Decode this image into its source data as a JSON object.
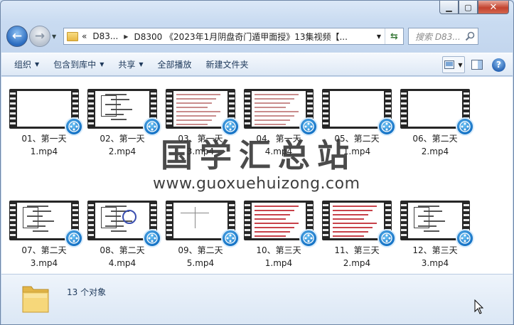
{
  "window": {
    "caption_buttons": [
      "minimize",
      "maximize",
      "close"
    ]
  },
  "address_bar": {
    "overflow": "«",
    "crumbs": [
      "D83...",
      "D8300 《2023年1月阴盘奇门遁甲面授》13集视频【..."
    ],
    "search_placeholder": "搜索 D83..."
  },
  "toolbar": {
    "organize": "组织",
    "include_in_library": "包含到库中",
    "share": "共享",
    "play_all": "全部播放",
    "new_folder": "新建文件夹"
  },
  "files": [
    {
      "line1": "01、第一天",
      "line2": "1.mp4"
    },
    {
      "line1": "02、第一天",
      "line2": "2.mp4"
    },
    {
      "line1": "03、第一天",
      "line2": "3.mp4"
    },
    {
      "line1": "04、第一天",
      "line2": "4.mp4"
    },
    {
      "line1": "05、第二天",
      "line2": "1.mp4"
    },
    {
      "line1": "06、第二天",
      "line2": "2.mp4"
    },
    {
      "line1": "07、第二天",
      "line2": "3.mp4"
    },
    {
      "line1": "08、第二天",
      "line2": "4.mp4"
    },
    {
      "line1": "09、第二天",
      "line2": "5.mp4"
    },
    {
      "line1": "10、第三天",
      "line2": "1.mp4"
    },
    {
      "line1": "11、第三天",
      "line2": "2.mp4"
    },
    {
      "line1": "12、第三天",
      "line2": "3.mp4"
    }
  ],
  "watermark": {
    "title": "国学汇总站",
    "url": "www.guoxuehuizong.com"
  },
  "status": {
    "object_count": "13 个对象"
  },
  "colors": {
    "accent": "#1e395b",
    "media_badge": "#1270c4",
    "close_button": "#c3432f"
  }
}
